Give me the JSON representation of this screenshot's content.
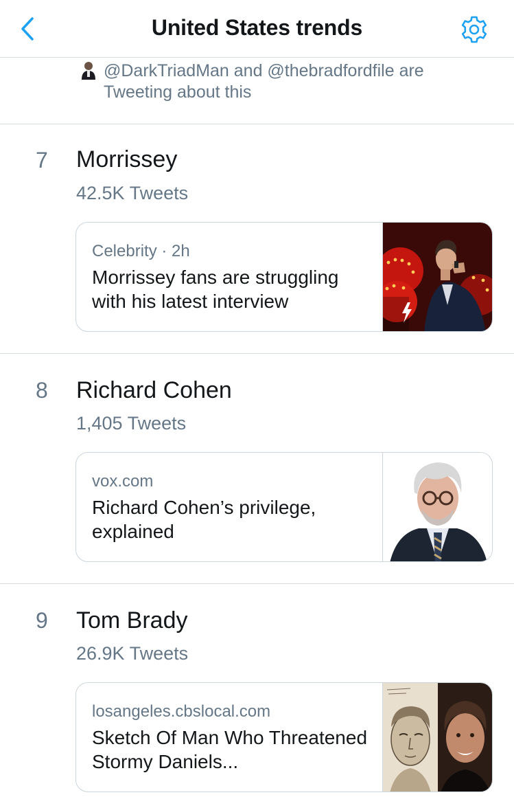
{
  "header": {
    "title": "United States trends"
  },
  "context": {
    "text": "@DarkTriadMan and @thebradfordfile are Tweeting about this"
  },
  "trends": [
    {
      "rank": "7",
      "name": "Morrissey",
      "count": "42.5K Tweets",
      "card": {
        "category": "Celebrity",
        "separator": "·",
        "time": "2h",
        "headline": "Morrissey fans are struggling with his latest interview"
      }
    },
    {
      "rank": "8",
      "name": "Richard Cohen",
      "count": "1,405 Tweets",
      "card": {
        "source": "vox.com",
        "headline": "Richard Cohen’s privilege, explained"
      }
    },
    {
      "rank": "9",
      "name": "Tom Brady",
      "count": "26.9K Tweets",
      "card": {
        "source": "losangeles.cbslocal.com",
        "headline": "Sketch Of Man Who Threatened Stormy Daniels..."
      }
    }
  ],
  "colors": {
    "accent": "#1da1f2",
    "secondary_text": "#657786",
    "primary_text": "#14171a",
    "divider": "#d6dbdf"
  }
}
